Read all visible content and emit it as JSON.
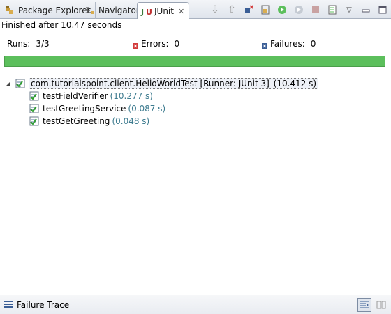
{
  "tabs": [
    {
      "label": "Package Explorer",
      "icon": "package-explorer-icon",
      "active": false
    },
    {
      "label": "Navigator",
      "icon": "navigator-icon",
      "active": false
    },
    {
      "label": "JUnit",
      "icon": "junit-icon",
      "active": true
    }
  ],
  "toolbar": {
    "buttons": [
      "next-failure-icon",
      "previous-failure-icon",
      "show-failures-only-icon",
      "scroll-lock-icon",
      "rerun-test-icon",
      "rerun-failed-first-icon",
      "stop-icon",
      "test-run-history-icon",
      "view-menu-icon",
      "minimize-icon",
      "maximize-icon"
    ]
  },
  "status": {
    "text": "Finished after 10.47 seconds"
  },
  "counters": {
    "runs_label": "Runs:",
    "runs_value": "3/3",
    "errors_label": "Errors:",
    "errors_value": "0",
    "failures_label": "Failures:",
    "failures_value": "0"
  },
  "progress": {
    "fraction": 1.0,
    "color": "#5cbf5c"
  },
  "tree": {
    "root": {
      "name": "com.tutorialspoint.client.HelloWorldTest [Runner: JUnit 3]",
      "time": "(10.412 s)"
    },
    "children": [
      {
        "name": "testFieldVerifier",
        "time": "(10.277 s)"
      },
      {
        "name": "testGreetingService",
        "time": "(0.087 s)"
      },
      {
        "name": "testGetGreeting",
        "time": "(0.048 s)"
      }
    ]
  },
  "failure_trace": {
    "label": "Failure Trace"
  },
  "colors": {
    "pass": "#5cbf5c",
    "error_icon": "#d23a3a",
    "failure_icon": "#3a5e96",
    "timing": "#3d7b8f"
  }
}
